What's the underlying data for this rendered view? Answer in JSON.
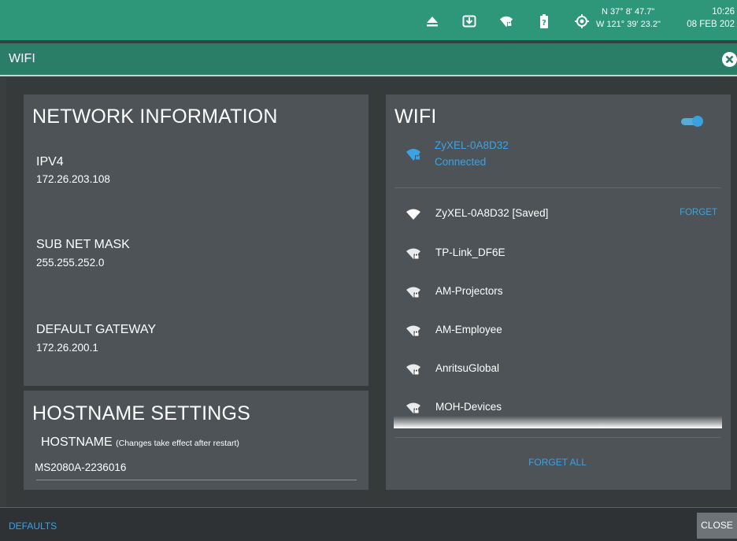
{
  "status_bar": {
    "coords": {
      "lat": "N 37° 8' 47.7\"",
      "lon": "W 121° 39' 23.2\""
    },
    "time": "10:26",
    "date": "08 FEB 202"
  },
  "window": {
    "title": "WIFI"
  },
  "network_information": {
    "title": "NETWORK INFORMATION",
    "ipv4": {
      "label": "IPV4",
      "value": "172.26.203.108"
    },
    "subnet": {
      "label": "SUB NET MASK",
      "value": "255.255.252.0"
    },
    "gateway": {
      "label": "DEFAULT GATEWAY",
      "value": "172.26.200.1"
    }
  },
  "hostname_settings": {
    "title": "HOSTNAME SETTINGS",
    "label": "HOSTNAME",
    "note": "(Changes take effect after restart)",
    "value": "MS2080A-2236016"
  },
  "wifi": {
    "title": "WIFI",
    "enabled": true,
    "connected": {
      "name": "ZyXEL-0A8D32",
      "status": "Connected"
    },
    "networks": [
      {
        "name": "ZyXEL-0A8D32 [Saved]",
        "secured": false,
        "forget_label": "FORGET"
      },
      {
        "name": "TP-Link_DF6E",
        "secured": true
      },
      {
        "name": "AM-Projectors",
        "secured": true
      },
      {
        "name": "AM-Employee",
        "secured": true
      },
      {
        "name": "AnritsuGlobal",
        "secured": true
      },
      {
        "name": "MOH-Devices",
        "secured": true
      }
    ],
    "forget_all_label": "FORGET ALL"
  },
  "footer": {
    "defaults_label": "DEFAULTS",
    "close_label": "CLOSE"
  },
  "colors": {
    "status_bar": "#2f9779",
    "title_bar": "#2a7e67",
    "panel": "#4d5357",
    "accent": "#3aa3e6"
  }
}
